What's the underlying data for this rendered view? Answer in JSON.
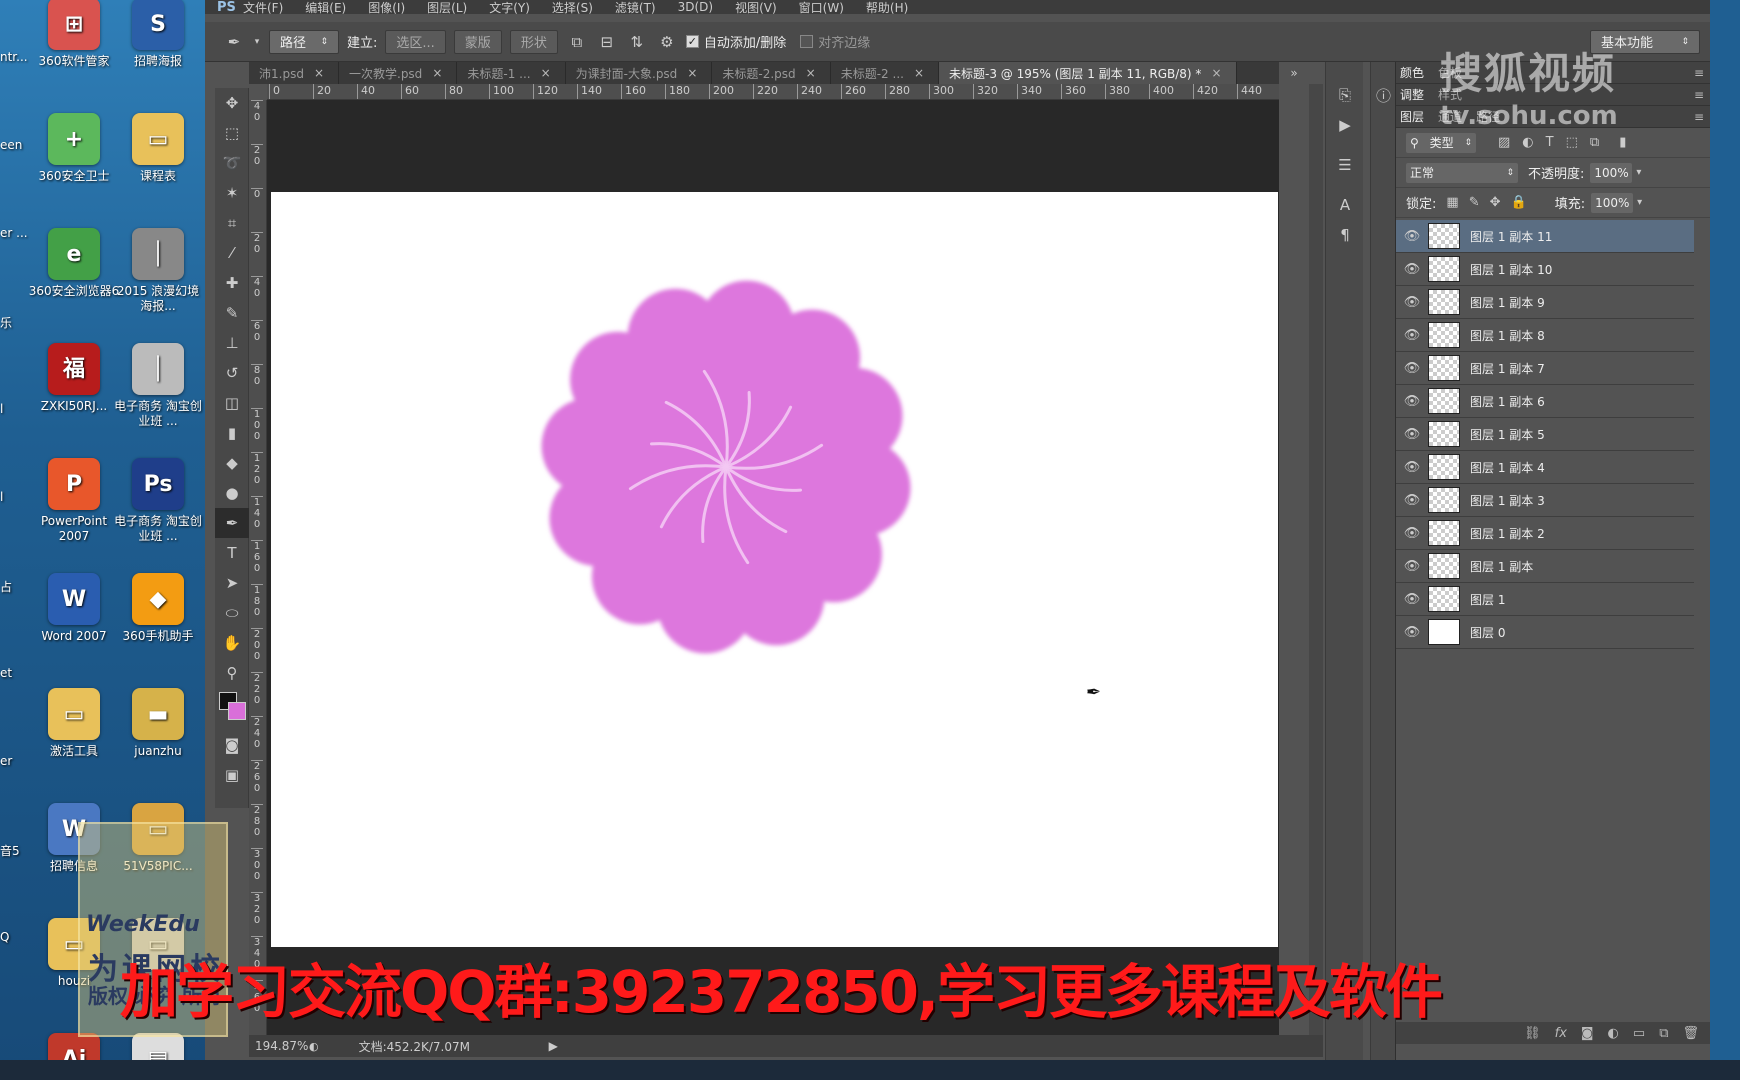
{
  "desktop": {
    "icons": [
      {
        "label": "360软件管家",
        "color": "#d9534f",
        "glyph": "⊞"
      },
      {
        "label": "招聘海报",
        "color": "#2b5fa8",
        "glyph": "S"
      },
      {
        "label": "360安全卫士",
        "color": "#5cb85c",
        "glyph": "+"
      },
      {
        "label": "课程表",
        "color": "#e8c15a",
        "glyph": "▭"
      },
      {
        "label": "360安全浏览器6",
        "color": "#43a047",
        "glyph": "e"
      },
      {
        "label": "2015 浪漫幻境海报...",
        "color": "#888888",
        "glyph": "│"
      },
      {
        "label": "ZXKI50RJ...",
        "color": "#b71c1c",
        "glyph": "福"
      },
      {
        "label": "电子商务 淘宝创业班 ...",
        "color": "#bbbbbb",
        "glyph": "│"
      },
      {
        "label": "PowerPoint 2007",
        "color": "#e8572b",
        "glyph": "P"
      },
      {
        "label": "电子商务 淘宝创业班 ...",
        "color": "#1f3e8a",
        "glyph": "Ps"
      },
      {
        "label": "Word 2007",
        "color": "#2a5db0",
        "glyph": "W"
      },
      {
        "label": "360手机助手",
        "color": "#f39c12",
        "glyph": "◆"
      },
      {
        "label": "激活工具",
        "color": "#e8c15a",
        "glyph": "▭"
      },
      {
        "label": "juanzhu",
        "color": "#d6b24a",
        "glyph": "▬"
      },
      {
        "label": "招聘信息",
        "color": "#4a78c2",
        "glyph": "W"
      },
      {
        "label": "51V58PIC...",
        "color": "#d9a441",
        "glyph": "▭"
      },
      {
        "label": "houzi",
        "color": "#e8c15a",
        "glyph": "▭"
      },
      {
        "label": "",
        "color": "#cccccc",
        "glyph": "▭"
      },
      {
        "label": "",
        "color": "#c0392b",
        "glyph": "Ai"
      },
      {
        "label": "",
        "color": "#dddddd",
        "glyph": "▤"
      }
    ],
    "edge_labels": [
      "ntr...",
      "een",
      "er ...",
      "乐",
      "l",
      "l",
      "占",
      "et",
      "er",
      "音5",
      "Q"
    ]
  },
  "menubar": {
    "logo": "PS",
    "items": [
      "文件(F)",
      "编辑(E)",
      "图像(I)",
      "图层(L)",
      "文字(Y)",
      "选择(S)",
      "滤镜(T)",
      "3D(D)",
      "视图(V)",
      "窗口(W)",
      "帮助(H)"
    ]
  },
  "options": {
    "mode": "路径",
    "build_label": "建立:",
    "btn_selection": "选区...",
    "btn_mask": "蒙版",
    "btn_shape": "形状",
    "auto_add_delete": "自动添加/删除",
    "align_edges": "对齐边缘",
    "workspace": "基本功能"
  },
  "tabs": [
    {
      "label": "沛1.psd",
      "active": false
    },
    {
      "label": "一次教学.psd",
      "active": false
    },
    {
      "label": "未标题-1 ...",
      "active": false
    },
    {
      "label": "为课封面-大象.psd",
      "active": false
    },
    {
      "label": "未标题-2.psd",
      "active": false
    },
    {
      "label": "未标题-2 ...",
      "active": false
    },
    {
      "label": "未标题-3 @ 195% (图层 1 副本 11, RGB/8) *",
      "active": true
    }
  ],
  "tabs_more": "»",
  "ruler": {
    "h": [
      "0",
      "20",
      "40",
      "60",
      "80",
      "100",
      "120",
      "140",
      "160",
      "180",
      "200",
      "220",
      "240",
      "260",
      "280",
      "300",
      "320",
      "340",
      "360",
      "380",
      "400",
      "420",
      "440"
    ],
    "v": [
      "4 0",
      "2 0",
      "0",
      "2 0",
      "4 0",
      "6 0",
      "8 0",
      "1 0 0",
      "1 2 0",
      "1 4 0",
      "1 6 0",
      "1 8 0",
      "2 0 0",
      "2 2 0",
      "2 4 0",
      "2 6 0",
      "2 8 0",
      "3 0 0",
      "3 2 0",
      "3 4 0",
      "3 6 0"
    ]
  },
  "flower": {
    "color": "#dd77dd",
    "streak_color": "#f3c8f3"
  },
  "statusbar": {
    "zoom": "194.87%",
    "doc": "文档:452.2K/7.07M"
  },
  "panels": {
    "row1": [
      "颜色",
      "色板"
    ],
    "row2": [
      "调整",
      "样式"
    ],
    "row3": [
      "图层",
      "通道",
      "路径"
    ],
    "filter_kind": "类型",
    "blend_mode": "正常",
    "opacity_label": "不透明度:",
    "opacity_value": "100%",
    "lock_label": "锁定:",
    "fill_label": "填充:",
    "fill_value": "100%",
    "layers": [
      {
        "name": "图层 1 副本 11",
        "selected": true,
        "white": false
      },
      {
        "name": "图层 1 副本 10",
        "selected": false,
        "white": false
      },
      {
        "name": "图层 1 副本 9",
        "selected": false,
        "white": false
      },
      {
        "name": "图层 1 副本 8",
        "selected": false,
        "white": false
      },
      {
        "name": "图层 1 副本 7",
        "selected": false,
        "white": false
      },
      {
        "name": "图层 1 副本 6",
        "selected": false,
        "white": false
      },
      {
        "name": "图层 1 副本 5",
        "selected": false,
        "white": false
      },
      {
        "name": "图层 1 副本 4",
        "selected": false,
        "white": false
      },
      {
        "name": "图层 1 副本 3",
        "selected": false,
        "white": false
      },
      {
        "name": "图层 1 副本 2",
        "selected": false,
        "white": false
      },
      {
        "name": "图层 1 副本",
        "selected": false,
        "white": false
      },
      {
        "name": "图层 1",
        "selected": false,
        "white": false
      },
      {
        "name": "图层 0",
        "selected": false,
        "white": true
      }
    ],
    "footer_icons": [
      "link-icon",
      "fx-icon",
      "mask-icon",
      "adjustment-icon",
      "folder-icon",
      "new-layer-icon",
      "trash-icon"
    ]
  },
  "watermark": {
    "line1": "搜狐视频",
    "line2": "tv.sohu.com"
  },
  "banner": "加学习交流QQ群:392372850,学习更多课程及软件",
  "logo_box": {
    "l1": "WeekEdu",
    "l2": "为课网校",
    "l3": "版权 必究 所有"
  }
}
